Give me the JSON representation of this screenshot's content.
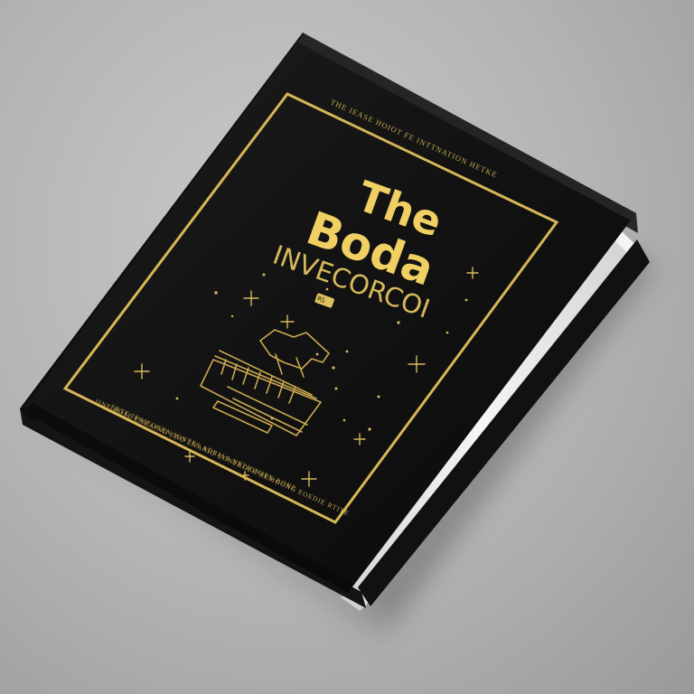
{
  "book": {
    "top_line": "THE IEASE HOIOT FE INTTNATION HETKE",
    "title_line_1": "The",
    "title_line_2": "Boda",
    "subtitle": "INVECORCOI",
    "badge": "RS",
    "bottom_line_1": "IINE ROSE ENEAIND EDO ENANIG EONEROER REMGONG EOEDIE RTITE",
    "bottom_line_2": "ERTE IFOIEOGEN IONTES ADRIAS NETIOMIEN BONE",
    "colors": {
      "cover": "#141414",
      "gold": "#e1c35f",
      "pages": "#e9e9e9",
      "background": "#b8b8b8"
    }
  }
}
